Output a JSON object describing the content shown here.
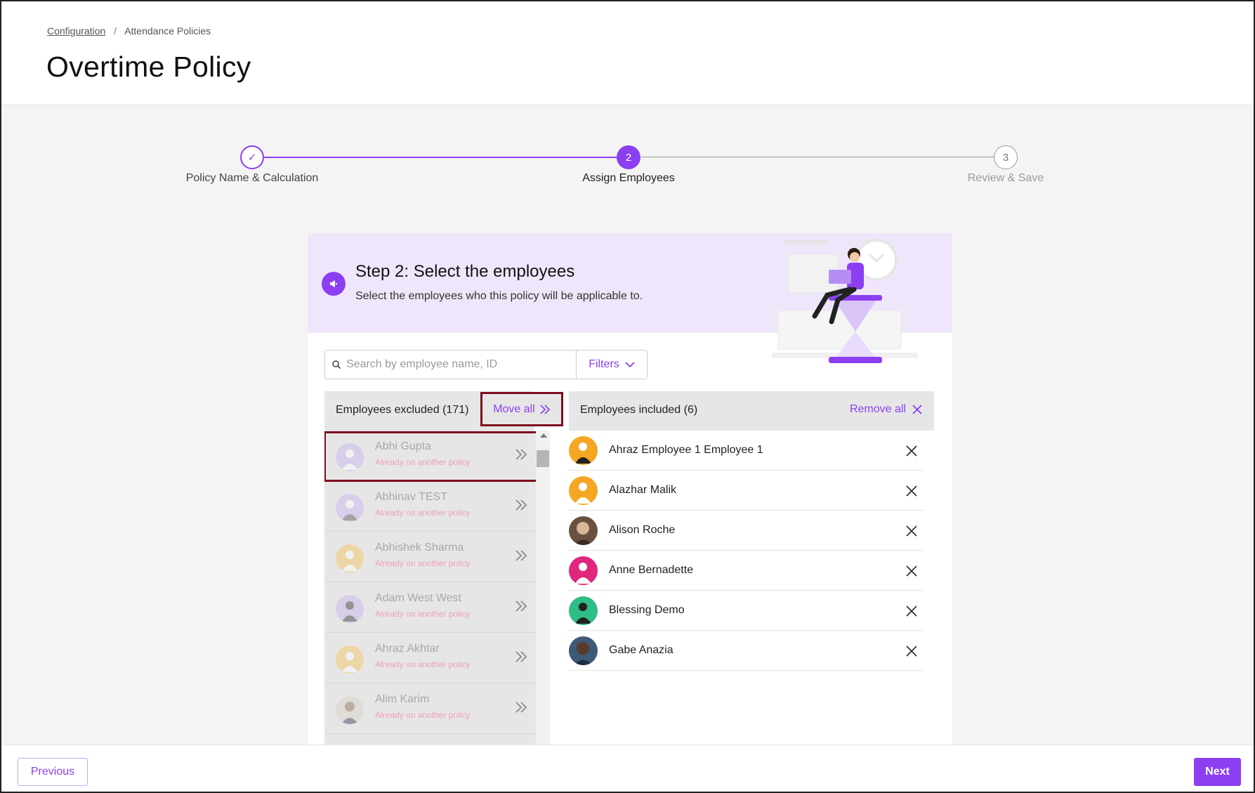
{
  "breadcrumb": {
    "parent": "Configuration",
    "current": "Attendance Policies"
  },
  "page_title": "Overtime Policy",
  "stepper": {
    "steps": [
      {
        "marker": "✓",
        "label": "Policy Name & Calculation",
        "state": "done"
      },
      {
        "marker": "2",
        "label": "Assign Employees",
        "state": "active"
      },
      {
        "marker": "3",
        "label": "Review & Save",
        "state": "upcoming"
      }
    ]
  },
  "banner": {
    "icon": "megaphone-icon",
    "title": "Step 2: Select the employees",
    "subtitle": "Select the employees who this policy will be applicable to."
  },
  "search": {
    "placeholder": "Search by employee name, ID",
    "value": "",
    "filters_label": "Filters"
  },
  "excluded": {
    "header": "Employees excluded (171)",
    "move_all_label": "Move all",
    "employees": [
      {
        "name": "Abhi Gupta",
        "note": "Already on another policy",
        "avatar_color": "#c9b3ef"
      },
      {
        "name": "Abhinav TEST",
        "note": "Already on another policy",
        "avatar_color": "#c9b3ef"
      },
      {
        "name": "Abhishek Sharma",
        "note": "Already on another policy",
        "avatar_color": "#f6c45a"
      },
      {
        "name": "Adam West West",
        "note": "Already on another policy",
        "avatar_color": "#c9b3ef"
      },
      {
        "name": "Ahraz Akhtar",
        "note": "Already on another policy",
        "avatar_color": "#f6c45a"
      },
      {
        "name": "Alim Karim",
        "note": "Already on another policy",
        "avatar_color": "#d8d0c8"
      }
    ]
  },
  "included": {
    "header": "Employees included (6)",
    "remove_all_label": "Remove all",
    "employees": [
      {
        "name": "Ahraz Employee 1 Employee 1",
        "avatar_color": "#f5a623"
      },
      {
        "name": "Alazhar Malik",
        "avatar_color": "#f5a623"
      },
      {
        "name": "Alison Roche",
        "avatar_color": "#6b5040"
      },
      {
        "name": "Anne Bernadette",
        "avatar_color": "#e0267d"
      },
      {
        "name": "Blessing Demo",
        "avatar_color": "#2ebd85"
      },
      {
        "name": "Gabe Anazia",
        "avatar_color": "#3e5a78"
      }
    ]
  },
  "footer": {
    "previous_label": "Previous",
    "next_label": "Next"
  },
  "colors": {
    "accent": "#8b3ff0",
    "highlight_border": "#7b0d1e",
    "banner_bg": "#efe6fb"
  }
}
